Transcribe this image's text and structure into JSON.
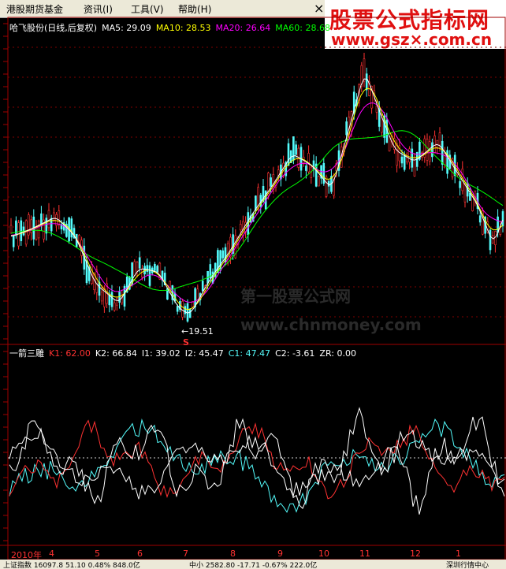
{
  "menu": {
    "items": [
      {
        "label": "港股期货基金"
      },
      {
        "label": "资讯(I)"
      },
      {
        "label": "工具(V)"
      },
      {
        "label": "帮助(H)"
      }
    ],
    "close_glyph": "×"
  },
  "watermark": {
    "line1": "股票公式指标网",
    "line2": "www.gsz×.com.cn",
    "center": "第一股票公式网",
    "center2": "www.chnmoney.com"
  },
  "main_legend": {
    "title": "哈飞股份(日线,后复权)",
    "ma5": "MA5: 29.09",
    "ma10": "MA10: 28.53",
    "ma20": "MA20: 26.64",
    "ma60": "MA60: 28.68"
  },
  "low_marker": {
    "label": "←19.51",
    "flag": "S"
  },
  "indicator_legend": {
    "name": "一箭三雕",
    "k1": "K1: 62.00",
    "k2": "K2: 66.84",
    "i1": "I1: 39.02",
    "i2": "I2: 45.47",
    "c1": "C1: 47.47",
    "c2": "C2: -3.61",
    "zr": "ZR: 0.00"
  },
  "x_axis": {
    "labels": [
      "2010年",
      "4",
      "5",
      "6",
      "7",
      "8",
      "9",
      "10",
      "11",
      "12",
      "1"
    ]
  },
  "status": {
    "left": "上证指数 16097.8  51.10  0.48%  848.0亿",
    "mid": "中小 2582.80  -17.71  -0.67%  222.0亿",
    "right": "深圳行情中心"
  },
  "colors": {
    "ma5": "#ffffff",
    "ma10": "#ffff00",
    "ma20": "#ff00ff",
    "ma60": "#00ff00",
    "up": "#ff3232",
    "down": "#54fcfc",
    "k1": "#ff3232",
    "c1": "#54fcfc"
  }
}
